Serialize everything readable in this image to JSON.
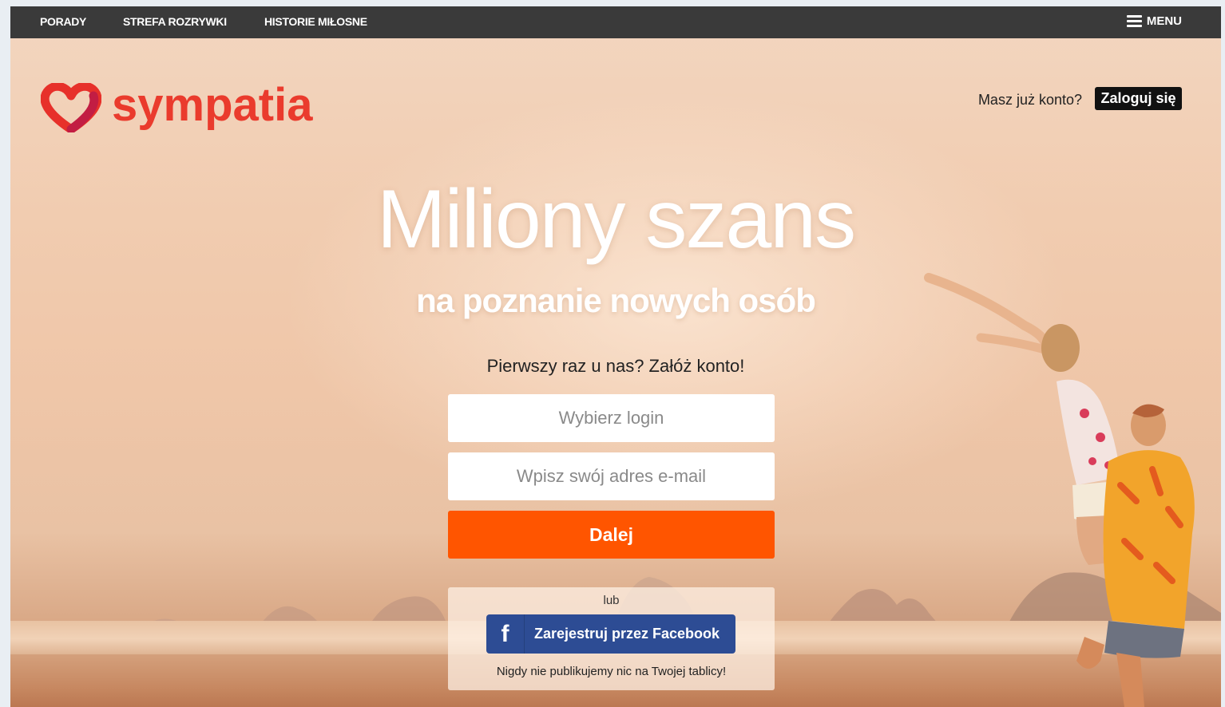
{
  "nav": {
    "items": [
      {
        "label": "PORADY"
      },
      {
        "label": "STREFA ROZRYWKI"
      },
      {
        "label": "HISTORIE MIŁOSNE"
      }
    ],
    "menu_label": "MENU"
  },
  "brand": {
    "name": "sympatia",
    "color": "#ea3b2d"
  },
  "account": {
    "prompt": "Masz już konto?",
    "login_label": "Zaloguj się"
  },
  "hero": {
    "headline": "Miliony szans",
    "subheadline": "na poznanie nowych osób"
  },
  "signup": {
    "title": "Pierwszy raz u nas? Załóż konto!",
    "login_placeholder": "Wybierz login",
    "email_placeholder": "Wpisz swój adres e-mail",
    "next_label": "Dalej",
    "next_color": "#ff5500"
  },
  "facebook": {
    "or_label": "lub",
    "icon_glyph": "f",
    "button_label": "Zarejestruj przez Facebook",
    "note": "Nigdy nie publikujemy nic na Twojej tablicy!",
    "color": "#2d4c94"
  }
}
